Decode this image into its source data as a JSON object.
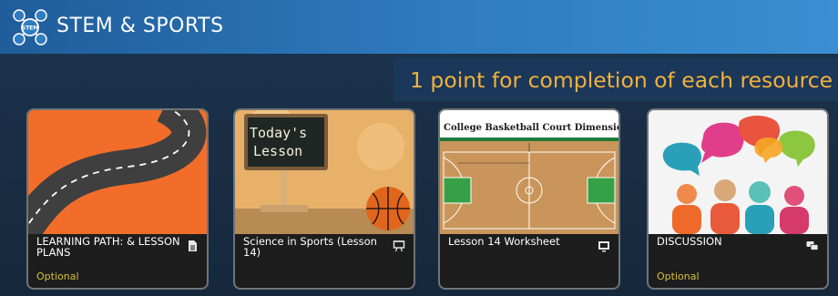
{
  "app": {
    "title": "STEM & SPORTS",
    "logo_center_text": "STEM"
  },
  "banner": {
    "text": "1 point for completion of each resource"
  },
  "cards": [
    {
      "title": "LEARNING PATH: & LESSON PLANS",
      "icon": "document-icon",
      "badge": "Optional"
    },
    {
      "title": "Science in Sports (Lesson 14)",
      "icon": "presentation-icon",
      "badge": "",
      "thumb_text": "Today's Lesson"
    },
    {
      "title": "Lesson 14 Worksheet",
      "icon": "screen-icon",
      "badge": "",
      "thumb_text": "College Basketball Court Dimensions"
    },
    {
      "title": "DISCUSSION",
      "icon": "chat-icon",
      "badge": "Optional"
    }
  ],
  "colors": {
    "header": "#2f7cc0",
    "banner_text": "#f2b13d",
    "badge": "#d8c03a",
    "card_bg": "#1d1d1d"
  }
}
